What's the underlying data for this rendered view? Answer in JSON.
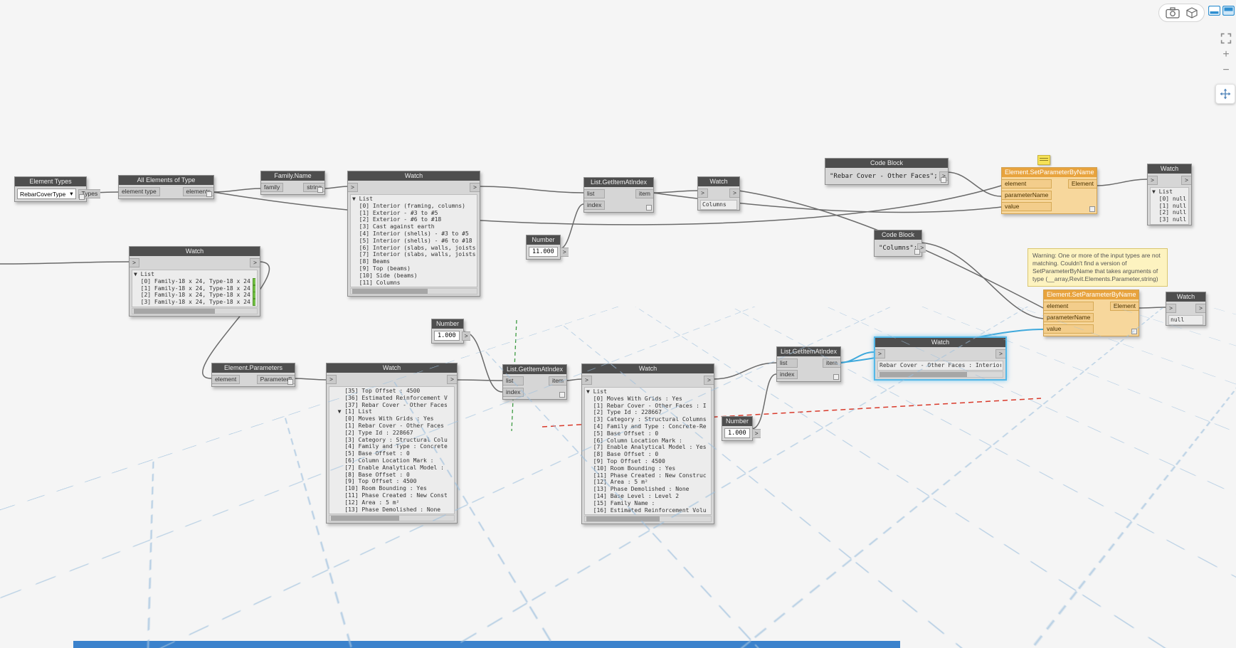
{
  "ui": {
    "chev": ">",
    "caret": "▾",
    "zoom_in": "+",
    "zoom_out": "−"
  },
  "warning": {
    "text": "Warning: One or more of the input types are not matching. Couldn't find a version of SetParameterByName that takes arguments of type (__array,Revit.Elements.Parameter,string)"
  },
  "nodes": {
    "element_types": {
      "title": "Element Types",
      "dropdown_value": "RebarCoverType",
      "output": "Types"
    },
    "all_elements_of_type": {
      "title": "All Elements of Type",
      "input": "element type",
      "output": "elements"
    },
    "family_name": {
      "title": "Family.Name",
      "input": "family",
      "output": "string"
    },
    "watch_top": {
      "title": "Watch",
      "rows": [
        "▼ List",
        "  [0] Interior (framing, columns)",
        "  [1] Exterior - #3 to #5",
        "  [2] Exterior - #6 to #18",
        "  [3] Cast against earth",
        "  [4] Interior (shells) - #3 to #5",
        "  [5] Interior (shells) - #6 to #18",
        "  [6] Interior (slabs, walls, joists)",
        "  [7] Interior (slabs, walls, joists)",
        "  [8] Beams",
        "  [9] Top (beams)",
        "  [10] Side (beams)",
        "  [11] Columns"
      ]
    },
    "gai_top": {
      "title": "List.GetItemAtIndex",
      "inputs": [
        "list",
        "index"
      ],
      "output": "item"
    },
    "number_11": {
      "title": "Number",
      "value": "11.000"
    },
    "watch_columns": {
      "title": "Watch",
      "value": "Columns"
    },
    "code_block_1": {
      "title": "Code Block",
      "code": "\"Rebar Cover - Other Faces\";"
    },
    "spbn_top": {
      "title": "Element.SetParameterByName",
      "inputs": [
        "element",
        "parameterName",
        "value"
      ],
      "output": "Element"
    },
    "watch_nulls": {
      "title": "Watch",
      "rows": [
        "▼ List",
        "  [0] null",
        "  [1] null",
        "  [2] null",
        "  [3] null"
      ]
    },
    "code_block_2": {
      "title": "Code Block",
      "code": "\"Columns\";"
    },
    "spbn_bottom": {
      "title": "Element.SetParameterByName",
      "inputs": [
        "element",
        "parameterName",
        "value"
      ],
      "output": "Element"
    },
    "watch_null": {
      "title": "Watch",
      "value": "null"
    },
    "watch_families": {
      "title": "Watch",
      "rows": [
        {
          "t": "▼ List"
        },
        {
          "t": "  [0] Family-18 x 24, Type-18 x 24",
          "b": true
        },
        {
          "t": "  [1] Family-18 x 24, Type-18 x 24",
          "b": true
        },
        {
          "t": "  [2] Family-18 x 24, Type-18 x 24",
          "b": true
        },
        {
          "t": "  [3] Family-18 x 24, Type-18 x 24",
          "b": true
        }
      ]
    },
    "element_parameters": {
      "title": "Element.Parameters",
      "input": "element",
      "output": "Parameter[]"
    },
    "number_1_top": {
      "title": "Number",
      "value": "1.000"
    },
    "watch_bl": {
      "title": "Watch",
      "rows": [
        "    [35] Top Offset : 4500",
        "    [36] Estimated Reinforcement V",
        "    [37] Rebar Cover - Other Faces",
        "  ▼ [1] List",
        "    [0] Moves With Grids : Yes",
        "    [1] Rebar Cover - Other Faces",
        "    [2] Type Id : 228667",
        "    [3] Category : Structural Colu",
        "    [4] Family and Type : Concrete",
        "    [5] Base Offset : 0",
        "    [6] Column Location Mark : ",
        "    [7] Enable Analytical Model : ",
        "    [8] Base Offset : 0",
        "    [9] Top Offset : 4500",
        "    [10] Room Bounding : Yes",
        "    [11] Phase Created : New Const",
        "    [12] Area : 5 m²",
        "    [13] Phase Demolished : None"
      ]
    },
    "gai_bottom": {
      "title": "List.GetItemAtIndex",
      "inputs": [
        "list",
        "index"
      ],
      "output": "item"
    },
    "watch_bm": {
      "title": "Watch",
      "rows": [
        "▼ List",
        "  [0] Moves With Grids : Yes",
        "  [1] Rebar Cover - Other Faces : I",
        "  [2] Type Id : 228667",
        "  [3] Category : Structural Columns",
        "  [4] Family and Type : Concrete-Re",
        "  [5] Base Offset : 0",
        "  [6] Column Location Mark : ",
        "  [7] Enable Analytical Model : Yes",
        "  [8] Base Offset : 0",
        "  [9] Top Offset : 4500",
        "  [10] Room Bounding : Yes",
        "  [11] Phase Created : New Construc",
        "  [12] Area : 5 m²",
        "  [13] Phase Demolished : None",
        "  [14] Base Level : Level 2",
        "  [15] Family Name : ",
        "  [16] Estimated Reinforcement Volu"
      ]
    },
    "number_1_bottom": {
      "title": "Number",
      "value": "1.000"
    },
    "gai_right": {
      "title": "List.GetItemAtIndex",
      "inputs": [
        "list",
        "index"
      ],
      "output": "item"
    },
    "watch_selected": {
      "title": "Watch",
      "value": "Rebar Cover - Other Faces : Interior ("
    }
  }
}
